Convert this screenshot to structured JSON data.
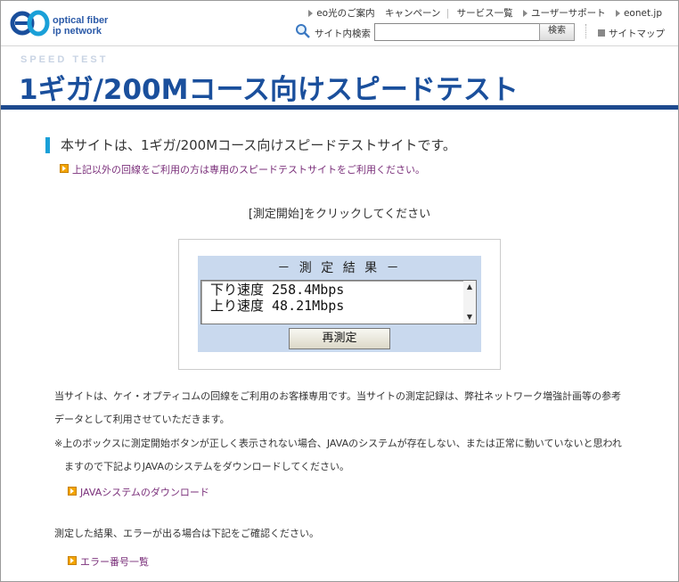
{
  "logo": {
    "line1": "optical fiber",
    "line2": "ip network"
  },
  "topnav": {
    "items": [
      "eo光のご案内",
      "キャンペーン",
      "サービス一覧",
      "ユーザーサポート",
      "eonet.jp"
    ],
    "separator": "|"
  },
  "search": {
    "label": "サイト内検索",
    "value": "",
    "button": "検索"
  },
  "sitemap": "サイトマップ",
  "header": {
    "section_label": "SPEED TEST",
    "title": "1ギガ/200Mコース向けスピードテスト"
  },
  "main": {
    "headline": "本サイトは、1ギガ/200Mコース向けスピードテストサイトです。",
    "note": "上記以外の回線をご利用の方は専用のスピードテストサイトをご利用ください。",
    "instruction": "[測定開始]をクリックしてください",
    "result": {
      "title": "－ 測 定 結 果 －",
      "lines": [
        "下り速度 258.4Mbps",
        "上り速度 48.21Mbps"
      ],
      "retest_button": "再測定"
    },
    "para1_line1": "当サイトは、ケイ・オプティコムの回線をご利用のお客様専用です。当サイトの測定記録は、弊社ネットワーク増強計画等の参考",
    "para1_line2": "データとして利用させていただきます。",
    "para2_line1": "※上のボックスに測定開始ボタンが正しく表示されない場合、JAVAのシステムが存在しない、または正常に動いていないと思われ",
    "para2_line2": "ますので下記よりJAVAのシステムをダウンロードしてください。",
    "java_link": "JAVAシステムのダウンロード",
    "para3": "測定した結果、エラーが出る場合は下記をご確認ください。",
    "error_link": "エラー番号一覧"
  },
  "colors": {
    "brand_blue": "#1a4f9c",
    "title_bar": "#1e4a8e",
    "accent_cyan": "#1aa0d8",
    "link_purple": "#7a2f7a",
    "panel_blue": "#c9d9ee"
  }
}
